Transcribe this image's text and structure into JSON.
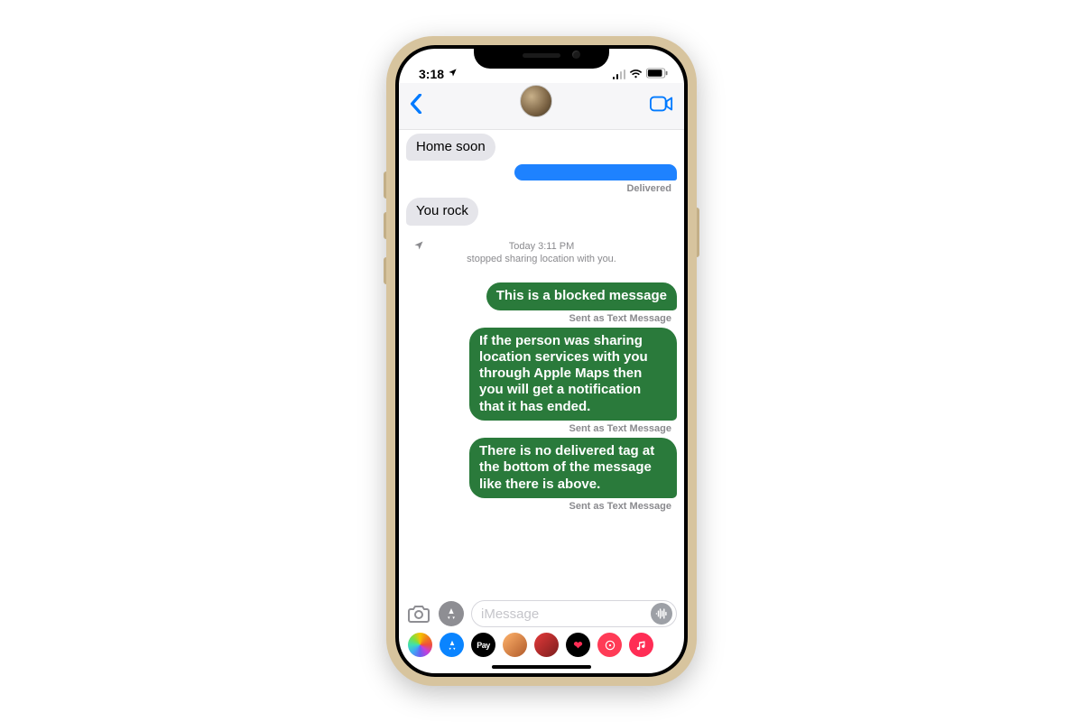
{
  "status_bar": {
    "time": "3:18",
    "location_arrow": "➤"
  },
  "header": {
    "back": "‹",
    "contact_name": ""
  },
  "top_cut_timestamp": "",
  "messages": [
    {
      "dir": "in",
      "text": "Home soon"
    },
    {
      "dir": "out",
      "text": "",
      "color": "blue",
      "status": "Delivered"
    },
    {
      "dir": "in",
      "text": "You rock"
    }
  ],
  "system_notice": {
    "time_label": "Today 3:11 PM",
    "body": "stopped sharing location with you."
  },
  "sms_messages": [
    {
      "text": "This is a blocked message",
      "status": "Sent as Text Message"
    },
    {
      "text": "If the person was sharing location services with you through Apple Maps then you will get a notification that it has ended.",
      "status": "Sent as Text Message"
    },
    {
      "text": "There is no delivered tag at the bottom of the message like there is above.",
      "status": "Sent as Text Message"
    }
  ],
  "compose": {
    "placeholder": "iMessage"
  },
  "drawer": {
    "pay_label": "Pay"
  }
}
